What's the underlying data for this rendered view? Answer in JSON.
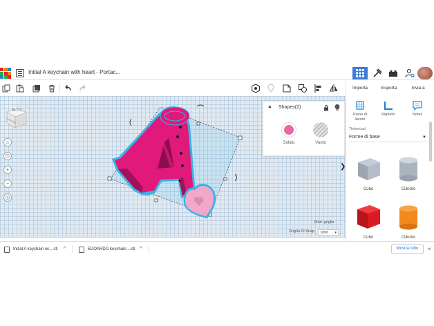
{
  "header": {
    "document_title": "Initial A keychain with heart - Portac...",
    "logo_colors": [
      "#e2231a",
      "#f08c1a",
      "#2a7fd4",
      "#1fb14b",
      "#e2231a",
      "#f08c1a",
      "#2a7fd4",
      "#1fb14b",
      "#e2231a"
    ],
    "right_buttons": [
      "grid-view-icon",
      "build-hammer-icon",
      "bricks-icon",
      "add-user-icon",
      "avatar"
    ],
    "active_color": "#3b7dd8"
  },
  "toolbar": {
    "left_tools": [
      "copy-icon",
      "paste-icon",
      "duplicate-icon",
      "delete-icon",
      "undo-icon",
      "redo-icon"
    ],
    "right_tools": [
      "note-visibility-icon",
      "light-bulb-icon",
      "notes-icon",
      "group-icon",
      "align-icon",
      "mirror-icon"
    ]
  },
  "viewcube": {
    "face_label": "ALTO",
    "side_label": "DAVANTI"
  },
  "view_controls": [
    "home-icon",
    "fit-icon",
    "zoom-in-icon",
    "zoom-out-icon",
    "perspective-icon"
  ],
  "inspector": {
    "title": "Shapes(2)",
    "solid_label": "Solido",
    "hole_label": "Vuoto",
    "solid_color": "#e56aa3"
  },
  "workplane": {
    "mod_griglia": "Mod. griglia",
    "snap_label": "Griglia Di Snap",
    "snap_value": "1mm"
  },
  "right_panel": {
    "tabs": [
      "Importa",
      "Esporta",
      "Invia a"
    ],
    "tools": [
      {
        "label": "Piano di lavoro"
      },
      {
        "label": "Righello"
      },
      {
        "label": "Notes"
      }
    ],
    "library_source": "Tinkercad",
    "library_value": "Forme di base",
    "shapes": [
      {
        "name": "Cubo",
        "color": "#a9b4c0"
      },
      {
        "name": "Cilindro",
        "color": "#a9b4c0"
      },
      {
        "name": "Cubo",
        "color": "#d81b24"
      },
      {
        "name": "Cilindro",
        "color": "#f08a1c"
      }
    ]
  },
  "downloads": {
    "items": [
      {
        "name": "Initial A keychain wi....stl"
      },
      {
        "name": "EDOARDO keychain....stl"
      }
    ],
    "show_all": "Mostra tutto"
  },
  "model": {
    "body_color": "#e0197a",
    "heart_color": "#f2a8c9",
    "outline_color": "#39b3e6"
  }
}
